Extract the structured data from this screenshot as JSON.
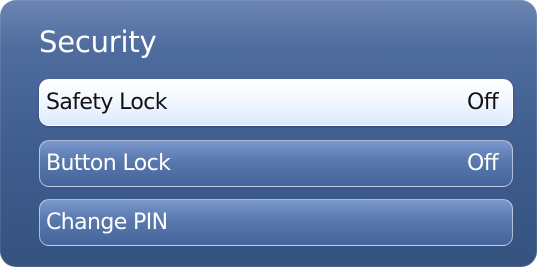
{
  "menu": {
    "title": "Security",
    "items": [
      {
        "label": "Safety Lock",
        "value": "Off"
      },
      {
        "label": "Button Lock",
        "value": "Off"
      },
      {
        "label": "Change PIN"
      }
    ]
  }
}
